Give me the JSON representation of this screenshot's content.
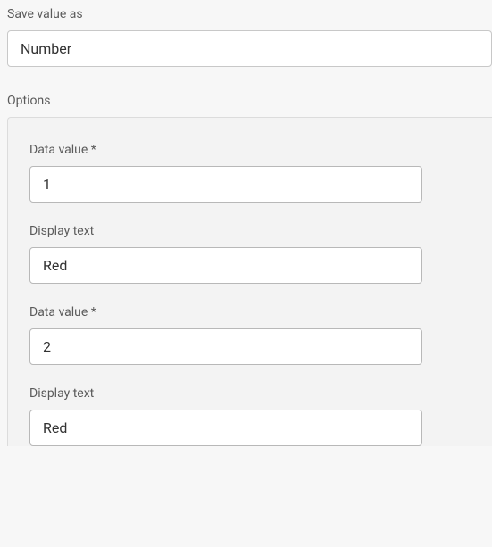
{
  "saveValueAs": {
    "label": "Save value as",
    "selected": "Number"
  },
  "options": {
    "label": "Options",
    "items": [
      {
        "dataValueLabel": "Data value *",
        "dataValue": "1",
        "displayTextLabel": "Display text",
        "displayText": "Red"
      },
      {
        "dataValueLabel": "Data value *",
        "dataValue": "2",
        "displayTextLabel": "Display text",
        "displayText": "Red"
      }
    ]
  }
}
